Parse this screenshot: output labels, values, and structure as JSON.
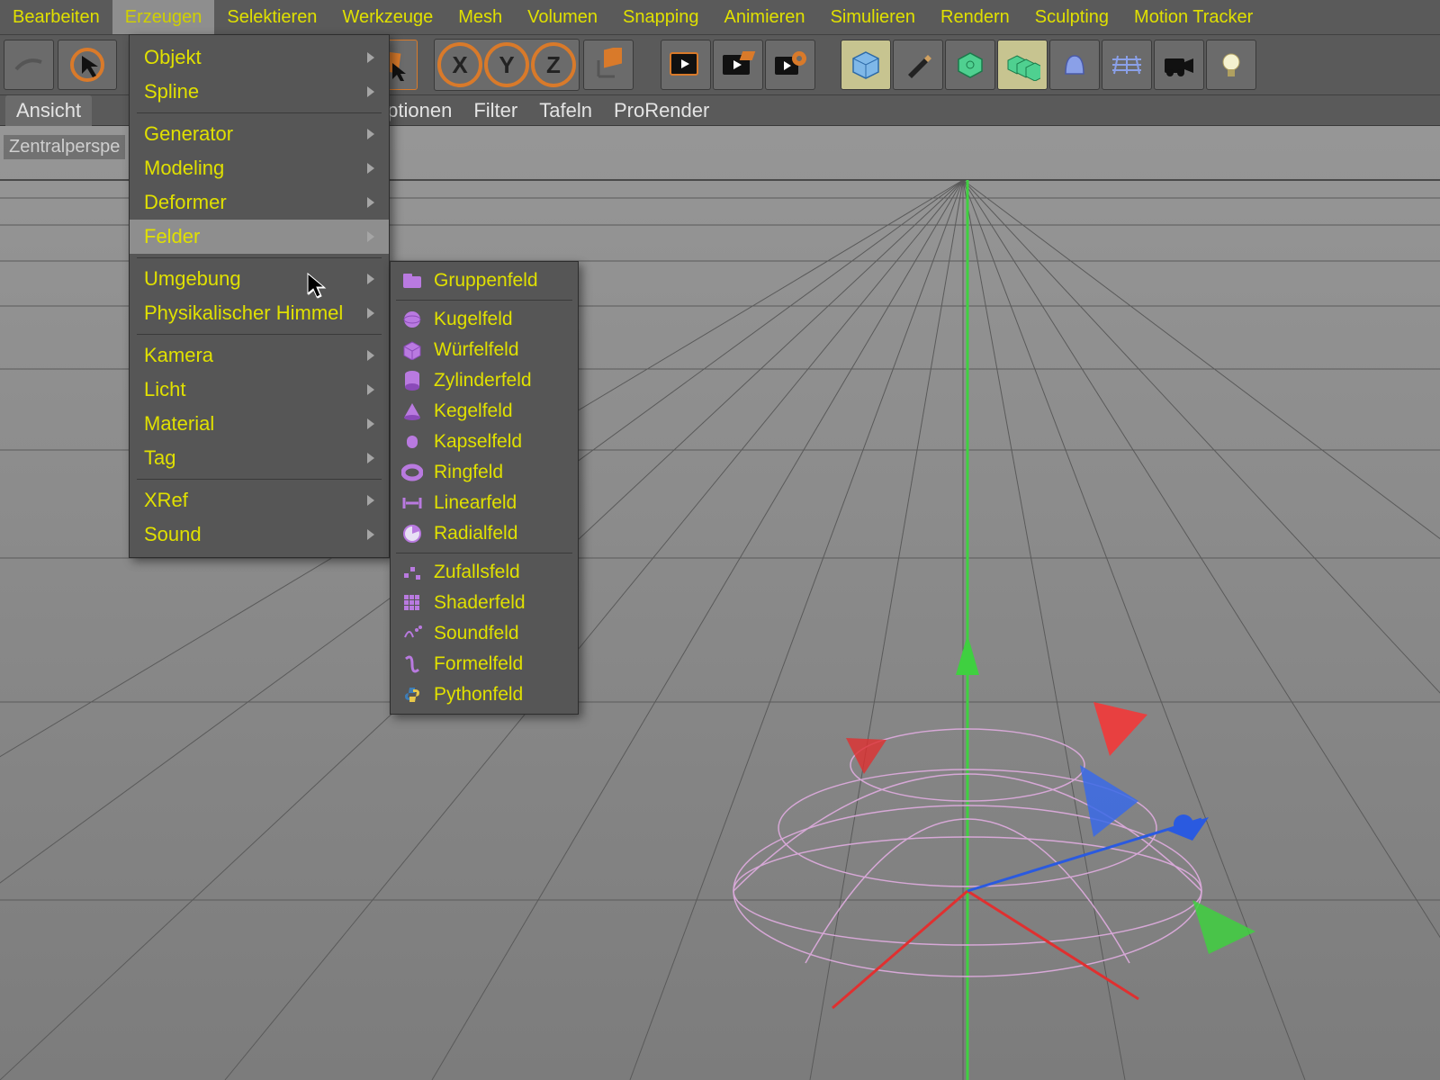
{
  "menubar": {
    "items": [
      {
        "label": "Bearbeiten"
      },
      {
        "label": "Erzeugen",
        "open": true
      },
      {
        "label": "Selektieren"
      },
      {
        "label": "Werkzeuge"
      },
      {
        "label": "Mesh"
      },
      {
        "label": "Volumen"
      },
      {
        "label": "Snapping"
      },
      {
        "label": "Animieren"
      },
      {
        "label": "Simulieren"
      },
      {
        "label": "Rendern"
      },
      {
        "label": "Sculpting"
      },
      {
        "label": "Motion Tracker"
      }
    ]
  },
  "toolbar": {
    "axis_x": "X",
    "axis_y": "Y",
    "axis_z": "Z"
  },
  "viewbar": {
    "tab": "Ansicht",
    "items": [
      {
        "label": "ptionen"
      },
      {
        "label": "Filter"
      },
      {
        "label": "Tafeln"
      },
      {
        "label": "ProRender"
      }
    ]
  },
  "viewport": {
    "projection_label": "Zentralperspe"
  },
  "dropdown": {
    "groups": [
      [
        {
          "label": "Objekt",
          "arrow": true
        },
        {
          "label": "Spline",
          "arrow": true
        }
      ],
      [
        {
          "label": "Generator",
          "arrow": true
        },
        {
          "label": "Modeling",
          "arrow": true
        },
        {
          "label": "Deformer",
          "arrow": true
        },
        {
          "label": "Felder",
          "arrow": true,
          "hover": true
        }
      ],
      [
        {
          "label": "Umgebung",
          "arrow": true
        },
        {
          "label": "Physikalischer Himmel",
          "arrow": true
        }
      ],
      [
        {
          "label": "Kamera",
          "arrow": true
        },
        {
          "label": "Licht",
          "arrow": true
        },
        {
          "label": "Material",
          "arrow": true
        },
        {
          "label": "Tag",
          "arrow": true
        }
      ],
      [
        {
          "label": "XRef",
          "arrow": true
        },
        {
          "label": "Sound",
          "arrow": true
        }
      ]
    ]
  },
  "submenu": {
    "groups": [
      [
        {
          "icon": "folder",
          "label": "Gruppenfeld"
        }
      ],
      [
        {
          "icon": "sphere",
          "label": "Kugelfeld"
        },
        {
          "icon": "cube",
          "label": "Würfelfeld"
        },
        {
          "icon": "cylinder",
          "label": "Zylinderfeld"
        },
        {
          "icon": "cone",
          "label": "Kegelfeld"
        },
        {
          "icon": "capsule",
          "label": "Kapselfeld"
        },
        {
          "icon": "torus",
          "label": "Ringfeld"
        },
        {
          "icon": "linear",
          "label": "Linearfeld"
        },
        {
          "icon": "radial",
          "label": "Radialfeld"
        }
      ],
      [
        {
          "icon": "random",
          "label": "Zufallsfeld"
        },
        {
          "icon": "shader",
          "label": "Shaderfeld"
        },
        {
          "icon": "sound",
          "label": "Soundfeld"
        },
        {
          "icon": "formula",
          "label": "Formelfeld"
        },
        {
          "icon": "python",
          "label": "Pythonfeld"
        }
      ]
    ]
  },
  "colors": {
    "accent": "#e0e000",
    "purple": "#b97ae0"
  }
}
